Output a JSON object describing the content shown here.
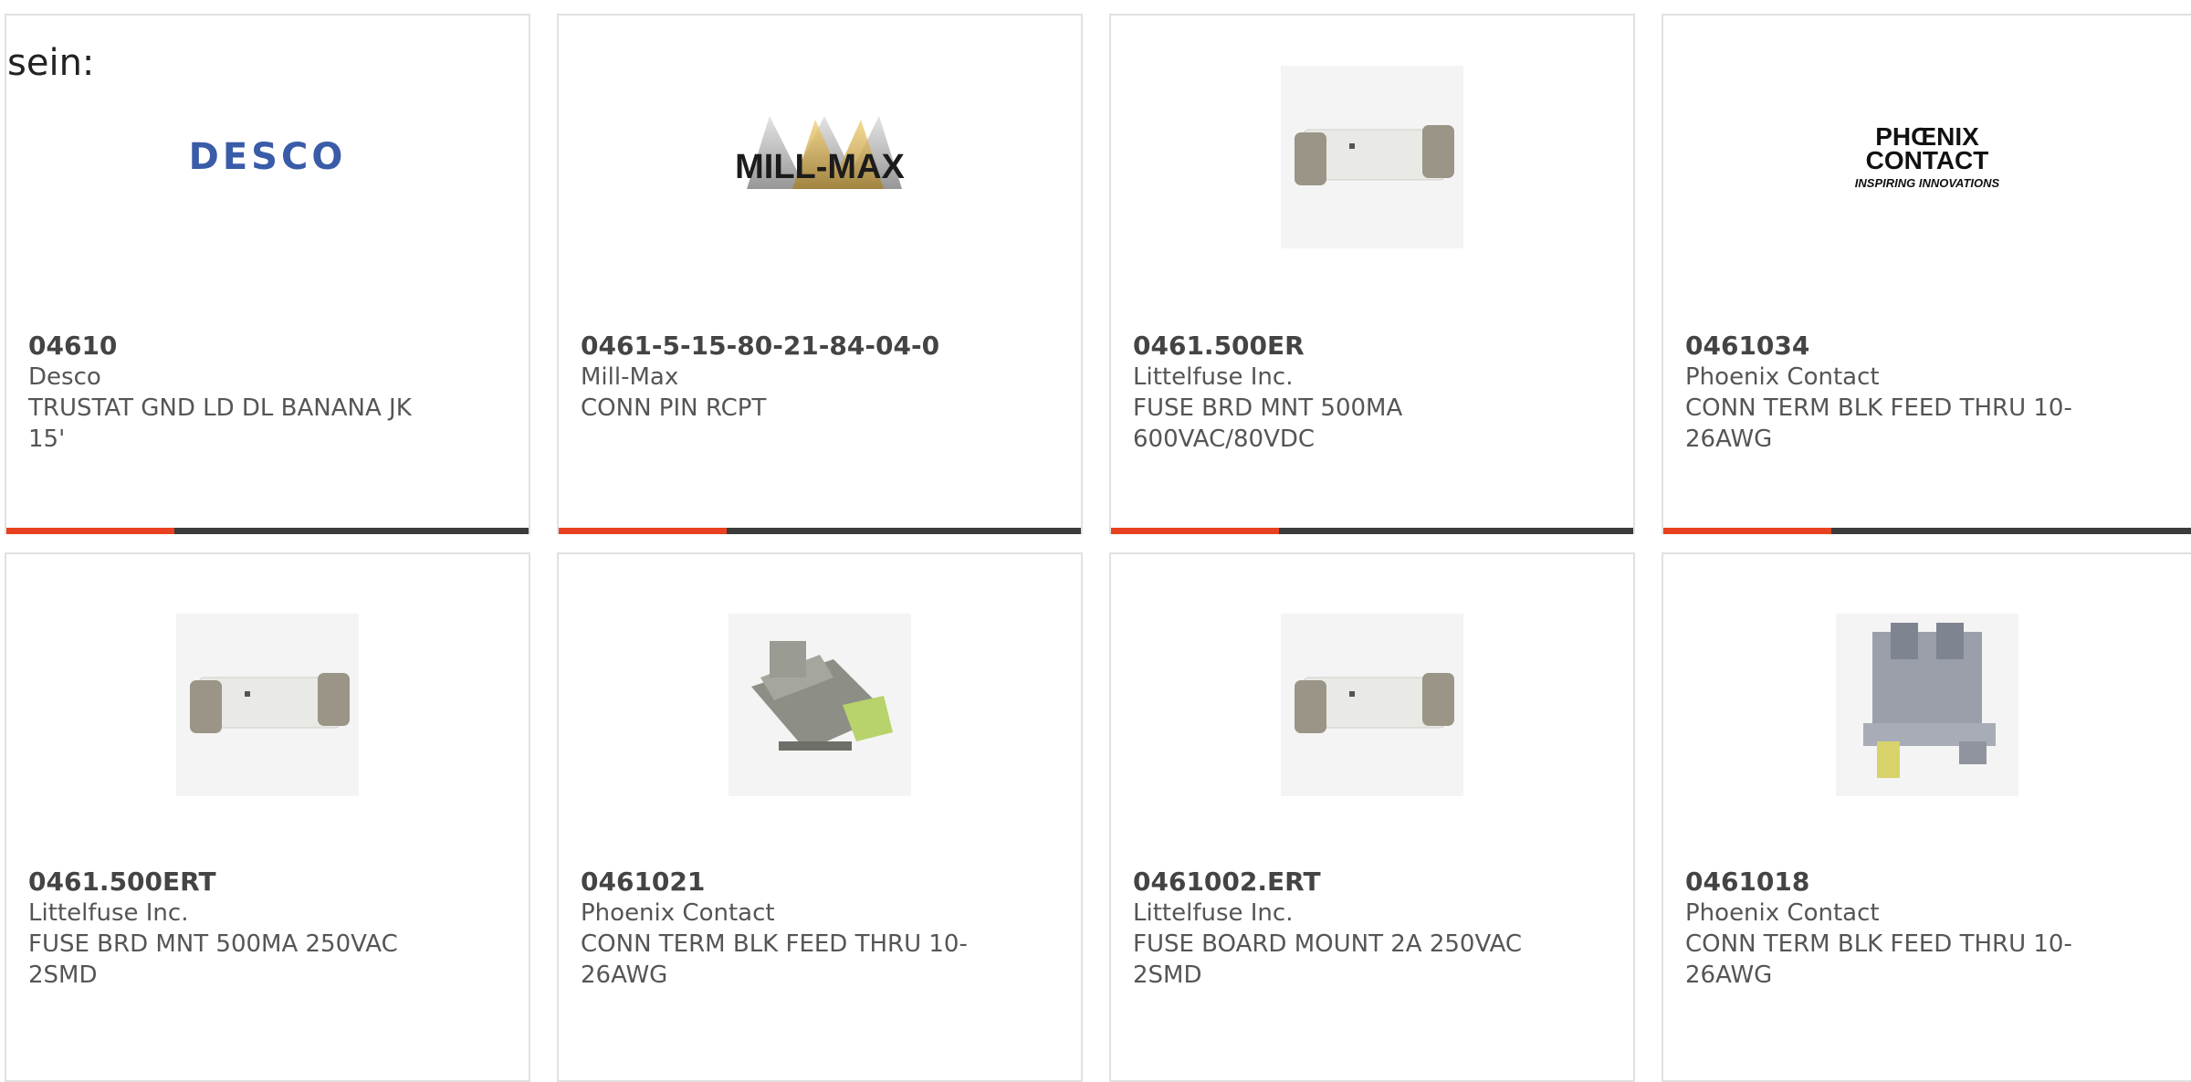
{
  "intro_text": "sein:",
  "products": [
    {
      "part": "04610",
      "manufacturer": "Desco",
      "description": "TRUSTAT GND LD DL BANANA JK 15'",
      "image": "desco-logo"
    },
    {
      "part": "0461-5-15-80-21-84-04-0",
      "manufacturer": "Mill-Max",
      "description": "CONN PIN RCPT",
      "image": "mill-max-logo"
    },
    {
      "part": "0461.500ER",
      "manufacturer": "Littelfuse Inc.",
      "description": "FUSE BRD MNT 500MA 600VAC/80VDC",
      "image": "fuse-photo"
    },
    {
      "part": "0461034",
      "manufacturer": "Phoenix Contact",
      "description": "CONN TERM BLK FEED THRU 10-26AWG",
      "image": "phoenix-contact-logo"
    },
    {
      "part": "0461.500ERT",
      "manufacturer": "Littelfuse Inc.",
      "description": "FUSE BRD MNT 500MA 250VAC 2SMD",
      "image": "fuse-photo"
    },
    {
      "part": "0461021",
      "manufacturer": "Phoenix Contact",
      "description": "CONN TERM BLK FEED THRU 10-26AWG",
      "image": "terminal-block-photo"
    },
    {
      "part": "0461002.ERT",
      "manufacturer": "Littelfuse Inc.",
      "description": "FUSE BOARD MOUNT 2A 250VAC 2SMD",
      "image": "fuse-photo"
    },
    {
      "part": "0461018",
      "manufacturer": "Phoenix Contact",
      "description": "CONN TERM BLK FEED THRU 10-26AWG",
      "image": "terminal-block-photo"
    }
  ],
  "logos": {
    "desco": "DESCO",
    "millmax": "MILL-MAX",
    "phoenix_big_1": "PHŒNIX",
    "phoenix_big_2": "CONTACT",
    "phoenix_small": "INSPIRING INNOVATIONS"
  },
  "colors": {
    "accent": "#e8411f",
    "bar": "#3b3b3b",
    "border": "#e1e1e1"
  }
}
